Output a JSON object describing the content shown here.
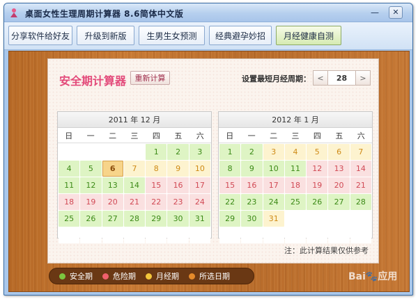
{
  "window": {
    "title": "桌面女性生理周期计算器 8.6简体中文版",
    "minimize_symbol": "—",
    "close_symbol": "✕"
  },
  "toolbar": {
    "items": [
      {
        "label": "分享软件给好友"
      },
      {
        "label": "升级到新版"
      },
      {
        "label": "生男生女预测"
      },
      {
        "label": "经典避孕妙招"
      },
      {
        "label": "月经健康自测"
      }
    ],
    "active_index": 4
  },
  "panel": {
    "title": "安全期计算器",
    "reset_label": "重新计算",
    "shortest_cycle_label": "设置最短月经周期：",
    "cycle_value": "28",
    "prev_symbol": "<",
    "next_symbol": ">",
    "note": "注：此计算结果仅供参考"
  },
  "calendars": [
    {
      "title": "2011 年 12 月",
      "weekdays": [
        "日",
        "一",
        "二",
        "三",
        "四",
        "五",
        "六"
      ],
      "days": [
        {
          "d": "",
          "s": "empty"
        },
        {
          "d": "",
          "s": "empty"
        },
        {
          "d": "",
          "s": "empty"
        },
        {
          "d": "",
          "s": "empty"
        },
        {
          "d": "1",
          "s": "safe"
        },
        {
          "d": "2",
          "s": "safe"
        },
        {
          "d": "3",
          "s": "safe"
        },
        {
          "d": "4",
          "s": "safe"
        },
        {
          "d": "5",
          "s": "safe"
        },
        {
          "d": "6",
          "s": "selected"
        },
        {
          "d": "7",
          "s": "period"
        },
        {
          "d": "8",
          "s": "period"
        },
        {
          "d": "9",
          "s": "period"
        },
        {
          "d": "10",
          "s": "period"
        },
        {
          "d": "11",
          "s": "safe"
        },
        {
          "d": "12",
          "s": "safe"
        },
        {
          "d": "13",
          "s": "safe"
        },
        {
          "d": "14",
          "s": "safe"
        },
        {
          "d": "15",
          "s": "danger"
        },
        {
          "d": "16",
          "s": "danger"
        },
        {
          "d": "17",
          "s": "danger"
        },
        {
          "d": "18",
          "s": "danger"
        },
        {
          "d": "19",
          "s": "danger"
        },
        {
          "d": "20",
          "s": "danger"
        },
        {
          "d": "21",
          "s": "danger"
        },
        {
          "d": "22",
          "s": "danger"
        },
        {
          "d": "23",
          "s": "danger"
        },
        {
          "d": "24",
          "s": "danger"
        },
        {
          "d": "25",
          "s": "safe"
        },
        {
          "d": "26",
          "s": "safe"
        },
        {
          "d": "27",
          "s": "safe"
        },
        {
          "d": "28",
          "s": "safe"
        },
        {
          "d": "29",
          "s": "safe"
        },
        {
          "d": "30",
          "s": "safe"
        },
        {
          "d": "31",
          "s": "safe"
        },
        {
          "d": "",
          "s": "empty"
        },
        {
          "d": "",
          "s": "empty"
        },
        {
          "d": "",
          "s": "empty"
        },
        {
          "d": "",
          "s": "empty"
        },
        {
          "d": "",
          "s": "empty"
        },
        {
          "d": "",
          "s": "empty"
        },
        {
          "d": "",
          "s": "empty"
        }
      ]
    },
    {
      "title": "2012 年 1 月",
      "weekdays": [
        "日",
        "一",
        "二",
        "三",
        "四",
        "五",
        "六"
      ],
      "days": [
        {
          "d": "1",
          "s": "safe"
        },
        {
          "d": "2",
          "s": "safe"
        },
        {
          "d": "3",
          "s": "period"
        },
        {
          "d": "4",
          "s": "period"
        },
        {
          "d": "5",
          "s": "period"
        },
        {
          "d": "6",
          "s": "period"
        },
        {
          "d": "7",
          "s": "period"
        },
        {
          "d": "8",
          "s": "safe"
        },
        {
          "d": "9",
          "s": "safe"
        },
        {
          "d": "10",
          "s": "safe"
        },
        {
          "d": "11",
          "s": "safe"
        },
        {
          "d": "12",
          "s": "danger"
        },
        {
          "d": "13",
          "s": "danger"
        },
        {
          "d": "14",
          "s": "danger"
        },
        {
          "d": "15",
          "s": "danger"
        },
        {
          "d": "16",
          "s": "danger"
        },
        {
          "d": "17",
          "s": "danger"
        },
        {
          "d": "18",
          "s": "danger"
        },
        {
          "d": "19",
          "s": "danger"
        },
        {
          "d": "20",
          "s": "danger"
        },
        {
          "d": "21",
          "s": "danger"
        },
        {
          "d": "22",
          "s": "safe"
        },
        {
          "d": "23",
          "s": "safe"
        },
        {
          "d": "24",
          "s": "safe"
        },
        {
          "d": "25",
          "s": "safe"
        },
        {
          "d": "26",
          "s": "safe"
        },
        {
          "d": "27",
          "s": "safe"
        },
        {
          "d": "28",
          "s": "safe"
        },
        {
          "d": "29",
          "s": "safe"
        },
        {
          "d": "30",
          "s": "safe"
        },
        {
          "d": "31",
          "s": "period"
        },
        {
          "d": "",
          "s": "empty"
        },
        {
          "d": "",
          "s": "empty"
        },
        {
          "d": "",
          "s": "empty"
        },
        {
          "d": "",
          "s": "empty"
        },
        {
          "d": "",
          "s": "empty"
        },
        {
          "d": "",
          "s": "empty"
        },
        {
          "d": "",
          "s": "empty"
        },
        {
          "d": "",
          "s": "empty"
        },
        {
          "d": "",
          "s": "empty"
        },
        {
          "d": "",
          "s": "empty"
        },
        {
          "d": "",
          "s": "empty"
        }
      ]
    }
  ],
  "legend": [
    {
      "label": "安全期",
      "color": "#7cc63f"
    },
    {
      "label": "危险期",
      "color": "#f0606c"
    },
    {
      "label": "月经期",
      "color": "#f3c63a"
    },
    {
      "label": "所选日期",
      "color": "#e58a2a"
    }
  ],
  "watermark": {
    "text": "Bai🐾应用"
  }
}
